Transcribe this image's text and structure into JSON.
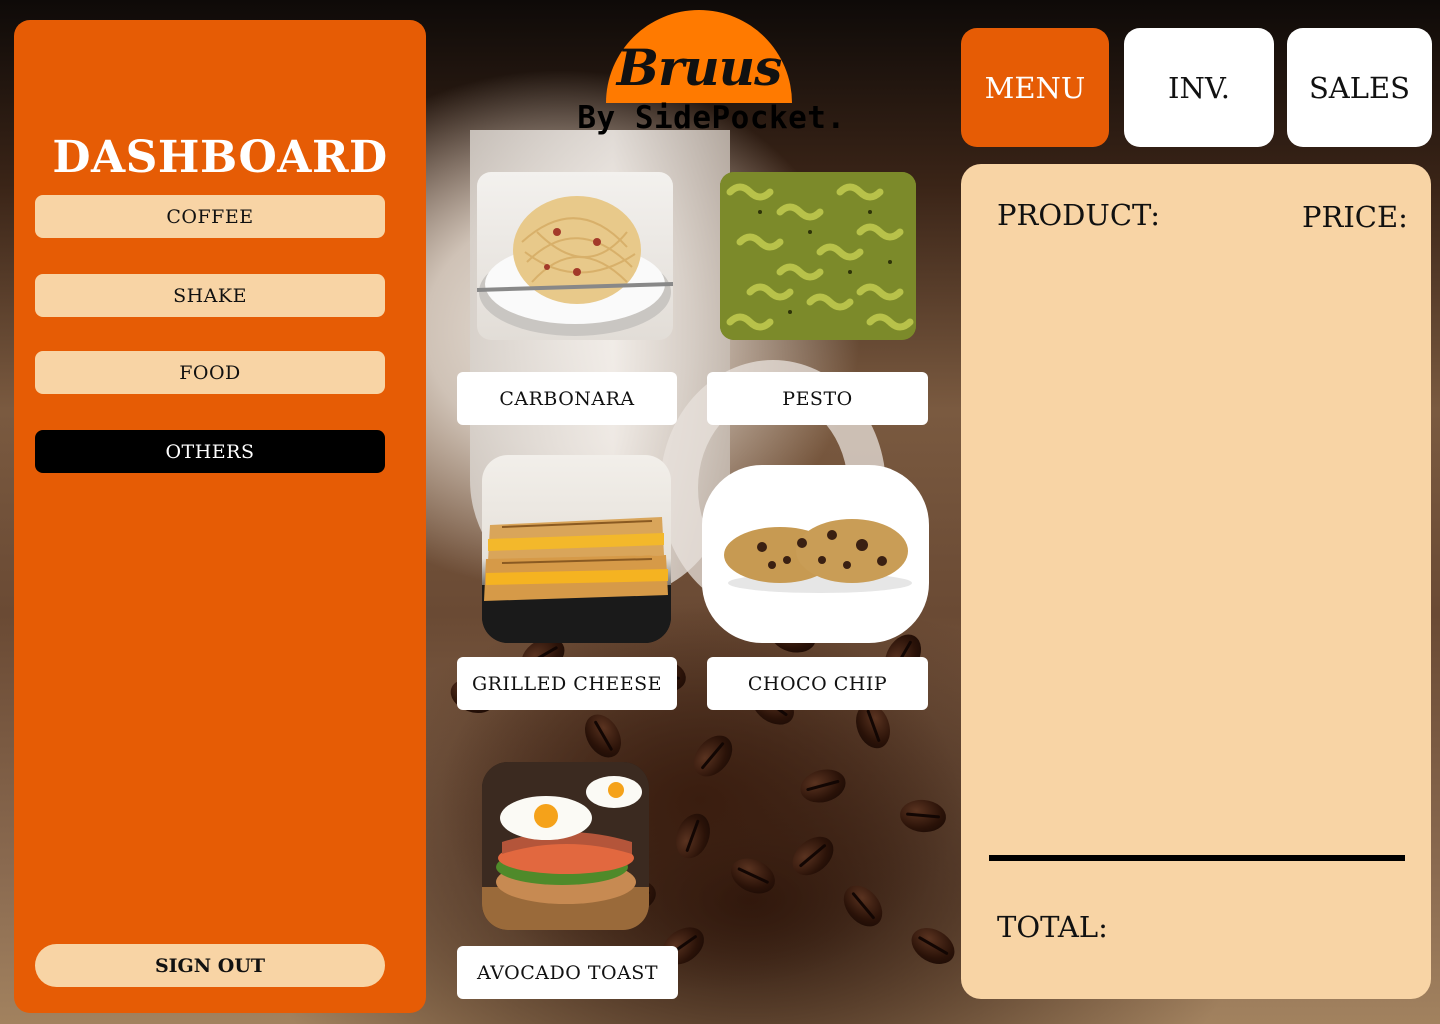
{
  "sidebar": {
    "title": "DASHBOARD",
    "categories": [
      {
        "label": "COFFEE",
        "active": false
      },
      {
        "label": "SHAKE",
        "active": false
      },
      {
        "label": "FOOD",
        "active": false
      },
      {
        "label": "OTHERS",
        "active": true
      }
    ],
    "sign_out": "SIGN OUT"
  },
  "brand": {
    "name": "Bruus",
    "tagline": "By SidePocket."
  },
  "top_tabs": [
    {
      "label": "MENU",
      "active": true
    },
    {
      "label": "INV.",
      "active": false
    },
    {
      "label": "SALES",
      "active": false
    }
  ],
  "products": [
    {
      "name": "CARBONARA",
      "image": "carbonara-pasta"
    },
    {
      "name": "PESTO",
      "image": "pesto-fusilli"
    },
    {
      "name": "GRILLED CHEESE",
      "image": "grilled-cheese-sandwich"
    },
    {
      "name": "CHOCO CHIP",
      "image": "chocolate-chip-cookies"
    },
    {
      "name": "AVOCADO TOAST",
      "image": "avocado-toast-egg"
    }
  ],
  "order": {
    "product_header": "PRODUCT:",
    "price_header": "PRICE:",
    "total_label": "TOTAL:"
  },
  "colors": {
    "accent": "#e65c05",
    "button_light": "#f8d4a5",
    "active_dark": "#000000",
    "logo_orange": "#ff7a00"
  }
}
